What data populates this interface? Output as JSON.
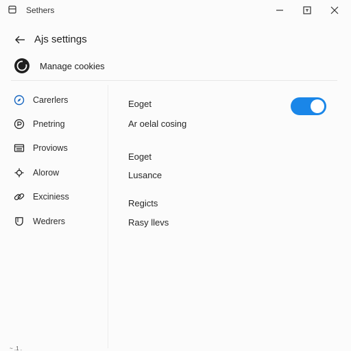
{
  "window": {
    "title": "Sethers"
  },
  "header": {
    "title": "Ajs settings",
    "manage_label": "Manage cookies"
  },
  "sidebar": {
    "items": [
      {
        "label": "Carerlers",
        "icon": "compass-icon"
      },
      {
        "label": "Pnetring",
        "icon": "palette-icon"
      },
      {
        "label": "Proviows",
        "icon": "list-icon"
      },
      {
        "label": "Alorow",
        "icon": "sparkle-icon"
      },
      {
        "label": "Exciniess",
        "icon": "link-icon"
      },
      {
        "label": "Wedrers",
        "icon": "shield-icon"
      }
    ]
  },
  "main": {
    "section1": {
      "title": "Eoget",
      "subtitle": "Ar oelal cosing",
      "toggle_on": true
    },
    "section2": {
      "title": "Eoget",
      "subtitle": "Lusance"
    },
    "section3": {
      "title": "Regicts",
      "subtitle": "Rasy llevs"
    }
  },
  "footer": {
    "text": "~ .1 ."
  },
  "colors": {
    "accent": "#1a86e8",
    "background": "#fbfbfb",
    "divider": "#e6e6e6"
  }
}
